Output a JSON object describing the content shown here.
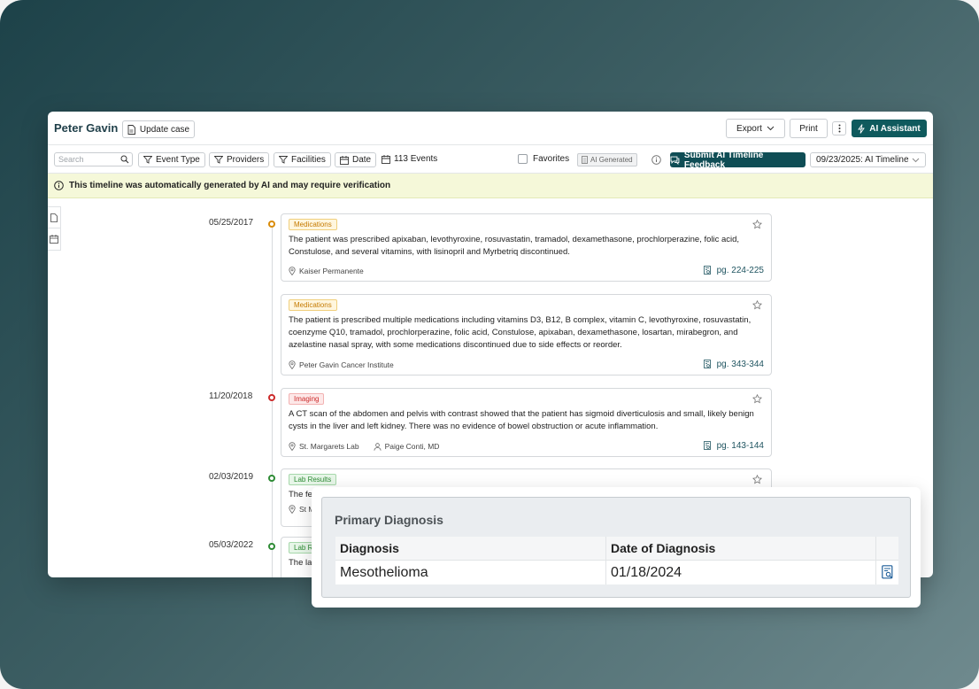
{
  "header": {
    "case_name": "Peter Gavin",
    "update_label": "Update case",
    "export_label": "Export",
    "print_label": "Print",
    "ai_assistant_label": "AI Assistant"
  },
  "filters": {
    "search_placeholder": "Search",
    "event_type": "Event Type",
    "providers": "Providers",
    "facilities": "Facilities",
    "date": "Date",
    "events_count": "113 Events",
    "favorites": "Favorites",
    "ai_generated": "AI Generated",
    "feedback_label": "Submit AI Timeline Feedback",
    "timeline_select": "09/23/2025: AI Timeline"
  },
  "banner": {
    "text": "This timeline was automatically generated by AI and may require verification"
  },
  "timeline": {
    "entries": [
      {
        "date": "05/25/2017",
        "tag": "Medications",
        "text": "The patient was prescribed apixaban, levothyroxine, rosuvastatin, tramadol, dexamethasone, prochlorperazine, folic acid, Constulose, and several vitamins, with lisinopril and Myrbetriq discontinued.",
        "facility": "Kaiser Permanente",
        "pages": "pg. 224-225"
      },
      {
        "tag": "Medications",
        "text": "The patient is prescribed multiple medications including vitamins D3, B12, B complex, vitamin C, levothyroxine, rosuvastatin, coenzyme Q10, tramadol, prochlorperazine, folic acid, Constulose, apixaban, dexamethasone, losartan, mirabegron, and azelastine nasal spray, with some medications discontinued due to side effects or reorder.",
        "facility": "Peter Gavin Cancer Institute",
        "pages": "pg. 343-344"
      },
      {
        "date": "11/20/2018",
        "tag": "Imaging",
        "text": "A CT scan of the abdomen and pelvis with contrast showed that the patient has sigmoid diverticulosis and small, likely benign cysts in the liver and left kidney. There was no evidence of bowel obstruction or acute inflammation.",
        "facility": "St. Margarets Lab",
        "provider": "Paige Conti, MD",
        "pages": "pg. 143-144"
      },
      {
        "date": "02/03/2019",
        "tag": "Lab Results",
        "text": "The fe",
        "facility": "St M"
      },
      {
        "date": "05/03/2022",
        "tag": "Lab R",
        "text": "The la"
      }
    ]
  },
  "diagnosis_panel": {
    "title": "Primary Diagnosis",
    "col_diagnosis": "Diagnosis",
    "col_date": "Date of Diagnosis",
    "diagnosis": "Mesothelioma",
    "date": "01/18/2024"
  },
  "colors": {
    "brand": "#0f5a5d",
    "medications": "#d98c0a",
    "imaging": "#cc2b2b",
    "lab_results": "#2e8b35",
    "banner": "#f5f8d9"
  }
}
